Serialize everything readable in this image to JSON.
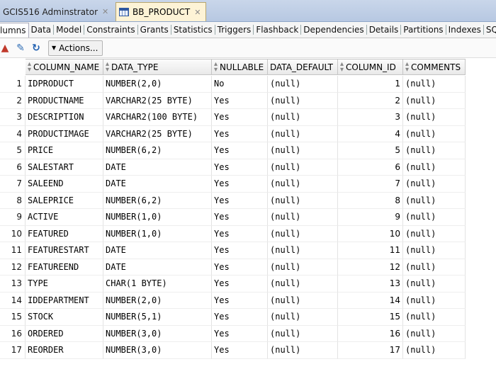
{
  "doc_tabs": [
    {
      "label": "GCIS516 Adminstrator",
      "close": "✕"
    },
    {
      "label": "BB_PRODUCT",
      "close": "✕"
    }
  ],
  "sub_tabs": [
    "lumns",
    "Data",
    "Model",
    "Constraints",
    "Grants",
    "Statistics",
    "Triggers",
    "Flashback",
    "Dependencies",
    "Details",
    "Partitions",
    "Indexes",
    "SQL"
  ],
  "toolbar": {
    "actions_label": "Actions..."
  },
  "columns": [
    "COLUMN_NAME",
    "DATA_TYPE",
    "NULLABLE",
    "DATA_DEFAULT",
    "COLUMN_ID",
    "COMMENTS"
  ],
  "rows": [
    {
      "n": "1",
      "name": "IDPRODUCT",
      "type": "NUMBER(2,0)",
      "nullable": "No",
      "default": "(null)",
      "id": "1",
      "comments": "(null)"
    },
    {
      "n": "2",
      "name": "PRODUCTNAME",
      "type": "VARCHAR2(25 BYTE)",
      "nullable": "Yes",
      "default": "(null)",
      "id": "2",
      "comments": "(null)"
    },
    {
      "n": "3",
      "name": "DESCRIPTION",
      "type": "VARCHAR2(100 BYTE)",
      "nullable": "Yes",
      "default": "(null)",
      "id": "3",
      "comments": "(null)"
    },
    {
      "n": "4",
      "name": "PRODUCTIMAGE",
      "type": "VARCHAR2(25 BYTE)",
      "nullable": "Yes",
      "default": "(null)",
      "id": "4",
      "comments": "(null)"
    },
    {
      "n": "5",
      "name": "PRICE",
      "type": "NUMBER(6,2)",
      "nullable": "Yes",
      "default": "(null)",
      "id": "5",
      "comments": "(null)"
    },
    {
      "n": "6",
      "name": "SALESTART",
      "type": "DATE",
      "nullable": "Yes",
      "default": "(null)",
      "id": "6",
      "comments": "(null)"
    },
    {
      "n": "7",
      "name": "SALEEND",
      "type": "DATE",
      "nullable": "Yes",
      "default": "(null)",
      "id": "7",
      "comments": "(null)"
    },
    {
      "n": "8",
      "name": "SALEPRICE",
      "type": "NUMBER(6,2)",
      "nullable": "Yes",
      "default": "(null)",
      "id": "8",
      "comments": "(null)"
    },
    {
      "n": "9",
      "name": "ACTIVE",
      "type": "NUMBER(1,0)",
      "nullable": "Yes",
      "default": "(null)",
      "id": "9",
      "comments": "(null)"
    },
    {
      "n": "10",
      "name": "FEATURED",
      "type": "NUMBER(1,0)",
      "nullable": "Yes",
      "default": "(null)",
      "id": "10",
      "comments": "(null)"
    },
    {
      "n": "11",
      "name": "FEATURESTART",
      "type": "DATE",
      "nullable": "Yes",
      "default": "(null)",
      "id": "11",
      "comments": "(null)"
    },
    {
      "n": "12",
      "name": "FEATUREEND",
      "type": "DATE",
      "nullable": "Yes",
      "default": "(null)",
      "id": "12",
      "comments": "(null)"
    },
    {
      "n": "13",
      "name": "TYPE",
      "type": "CHAR(1 BYTE)",
      "nullable": "Yes",
      "default": "(null)",
      "id": "13",
      "comments": "(null)"
    },
    {
      "n": "14",
      "name": "IDDEPARTMENT",
      "type": "NUMBER(2,0)",
      "nullable": "Yes",
      "default": "(null)",
      "id": "14",
      "comments": "(null)"
    },
    {
      "n": "15",
      "name": "STOCK",
      "type": "NUMBER(5,1)",
      "nullable": "Yes",
      "default": "(null)",
      "id": "15",
      "comments": "(null)"
    },
    {
      "n": "16",
      "name": "ORDERED",
      "type": "NUMBER(3,0)",
      "nullable": "Yes",
      "default": "(null)",
      "id": "16",
      "comments": "(null)"
    },
    {
      "n": "17",
      "name": "REORDER",
      "type": "NUMBER(3,0)",
      "nullable": "Yes",
      "default": "(null)",
      "id": "17",
      "comments": "(null)"
    }
  ],
  "icons": [
    "pin-icon",
    "edit-icon",
    "refresh-icon",
    "table-icon",
    "sort-icon",
    "dropdown-triangle-icon"
  ]
}
